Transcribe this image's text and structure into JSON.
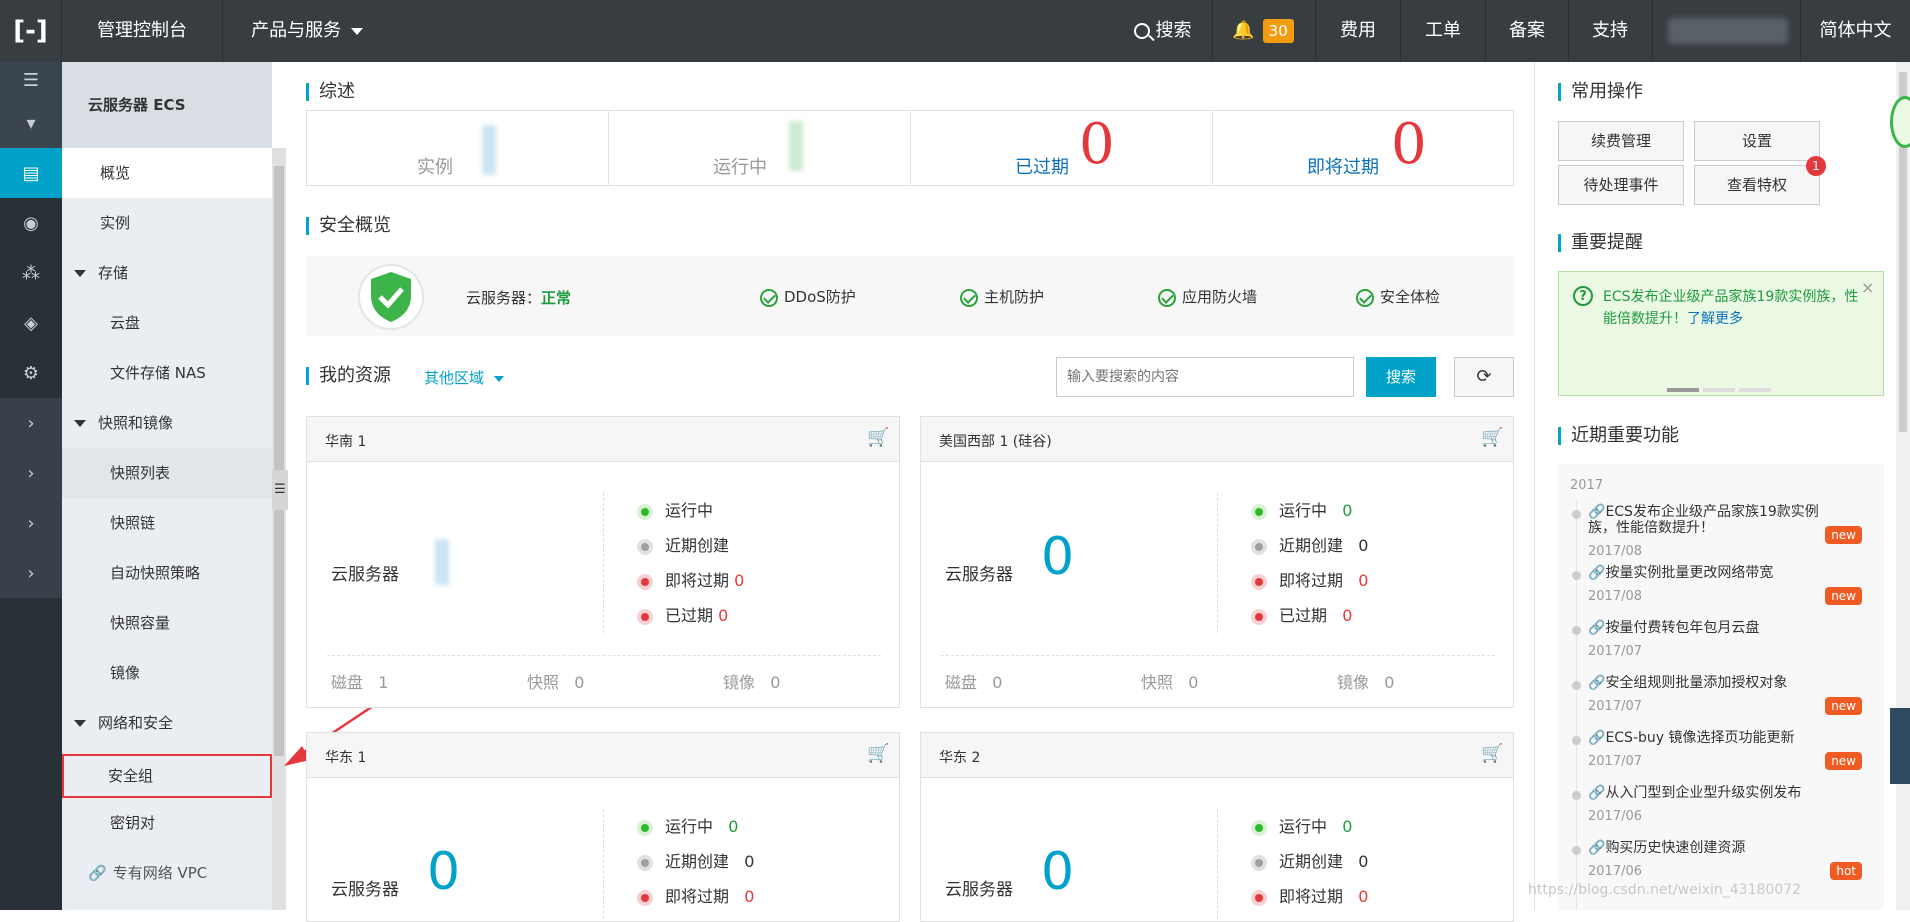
{
  "topbar": {
    "logo": "[-]",
    "console": "管理控制台",
    "products": "产品与服务",
    "search": "搜索",
    "notifications_count": "30",
    "billing": "费用",
    "ticket": "工单",
    "icp": "备案",
    "support": "支持",
    "language": "简体中文"
  },
  "menu": {
    "header": "云服务器 ECS",
    "items": {
      "overview": "概览",
      "instances": "实例",
      "storage": "存储",
      "disks": "云盘",
      "nas": "文件存储 NAS",
      "snapshots_images": "快照和镜像",
      "snapshot_list": "快照列表",
      "snapshot_chain": "快照链",
      "auto_snapshot": "自动快照策略",
      "snapshot_capacity": "快照容量",
      "images": "镜像",
      "network_security": "网络和安全",
      "security_group": "安全组",
      "key_pair": "密钥对",
      "vpc": "专有网络 VPC"
    }
  },
  "summary": {
    "title": "综述",
    "instances": "实例",
    "running": "运行中",
    "expired": "已过期",
    "expired_value": "0",
    "expiring": "即将过期",
    "expiring_value": "0"
  },
  "security": {
    "title": "安全概览",
    "server_label": "云服务器：",
    "server_status": "正常",
    "ddos": "DDoS防护",
    "host": "主机防护",
    "waf": "应用防火墙",
    "check": "安全体检"
  },
  "resources": {
    "title": "我的资源",
    "region_dropdown": "其他区域",
    "search_placeholder": "输入要搜索的内容",
    "search_button": "搜索",
    "cards": [
      {
        "region": "华南 1",
        "server_label": "云服务器",
        "server_count": "",
        "running": "运行中",
        "running_v": "",
        "recent": "近期创建",
        "recent_v": "",
        "expiring": "即将过期",
        "expiring_v": "0",
        "expired": "已过期",
        "expired_v": "0",
        "disk": "磁盘",
        "disk_v": "1",
        "snap": "快照",
        "snap_v": "0",
        "image": "镜像",
        "image_v": "0"
      },
      {
        "region": "美国西部 1 (硅谷)",
        "server_label": "云服务器",
        "server_count": "0",
        "running": "运行中",
        "running_v": "0",
        "recent": "近期创建",
        "recent_v": "0",
        "expiring": "即将过期",
        "expiring_v": "0",
        "expired": "已过期",
        "expired_v": "0",
        "disk": "磁盘",
        "disk_v": "0",
        "snap": "快照",
        "snap_v": "0",
        "image": "镜像",
        "image_v": "0"
      },
      {
        "region": "华东 1",
        "server_label": "云服务器",
        "server_count": "0",
        "running": "运行中",
        "running_v": "0",
        "recent": "近期创建",
        "recent_v": "0",
        "expiring": "即将过期",
        "expiring_v": "0"
      },
      {
        "region": "华东 2",
        "server_label": "云服务器",
        "server_count": "0",
        "running": "运行中",
        "running_v": "0",
        "recent": "近期创建",
        "recent_v": "0",
        "expiring": "即将过期",
        "expiring_v": "0"
      }
    ]
  },
  "sidebar": {
    "common_ops_title": "常用操作",
    "renew": "续费管理",
    "settings": "设置",
    "pending": "待处理事件",
    "privileges": "查看特权",
    "privileges_badge": "1",
    "reminder_title": "重要提醒",
    "reminder_text": "ECS发布企业级产品家族19款实例族，性能倍数提升！",
    "reminder_link": "了解更多",
    "features_title": "近期重要功能",
    "year": "2017",
    "features": [
      {
        "text": "ECS发布企业级产品家族19款实例族，性能倍数提升！",
        "date": "2017/08",
        "tag": "new"
      },
      {
        "text": "按量实例批量更改网络带宽",
        "date": "2017/08",
        "tag": "new"
      },
      {
        "text": "按量付费转包年包月云盘",
        "date": "2017/07",
        "tag": ""
      },
      {
        "text": "安全组规则批量添加授权对象",
        "date": "2017/07",
        "tag": "new"
      },
      {
        "text": "ECS-buy 镜像选择页功能更新",
        "date": "2017/07",
        "tag": "new"
      },
      {
        "text": "从入门型到企业型升级实例发布",
        "date": "2017/06",
        "tag": ""
      },
      {
        "text": "购买历史快速创建资源",
        "date": "2017/06",
        "tag": "hot"
      }
    ],
    "watermark": "https://blog.csdn.net/weixin_43180072"
  },
  "colors": {
    "accent": "#00a2ca",
    "topbar": "#373d41",
    "danger": "#e4393c",
    "ok": "#1e9b3d"
  }
}
